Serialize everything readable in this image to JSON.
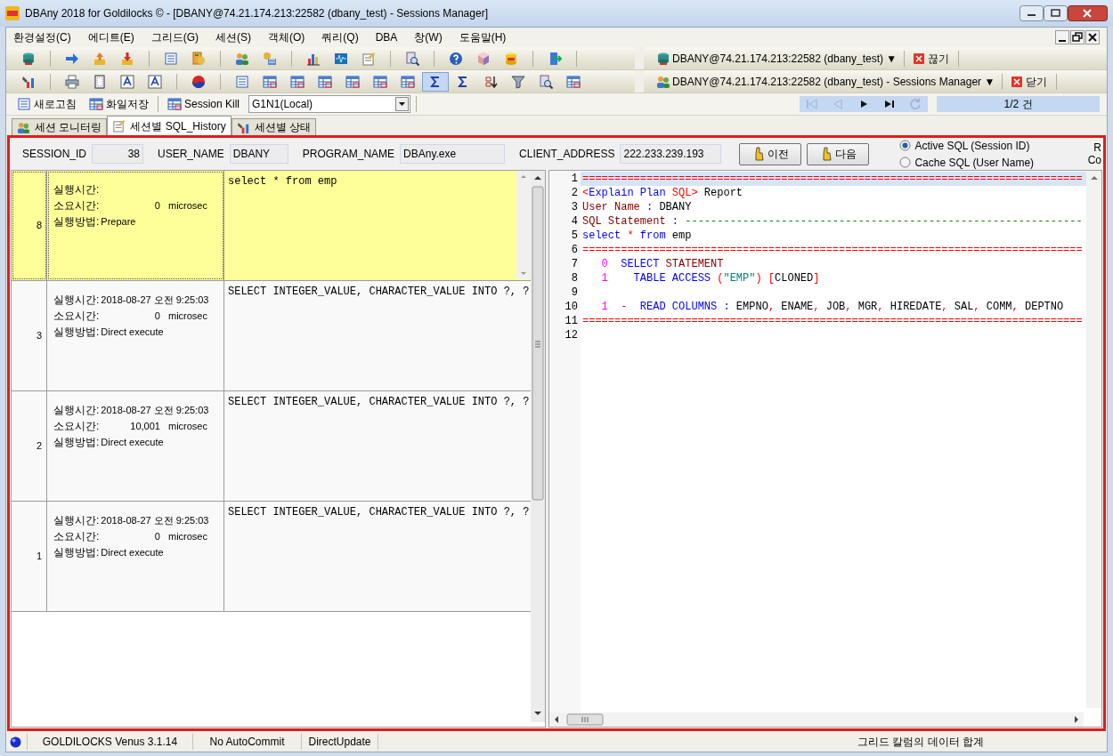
{
  "window": {
    "title": "DBAny 2018 for Goldilocks © - [DBANY@74.21.174.213:22582 (dbany_test) - Sessions Manager]"
  },
  "menu": [
    "환경설정(C)",
    "에디트(E)",
    "그리드(G)",
    "세션(S)",
    "객체(O)",
    "쿼리(Q)",
    "DBA",
    "창(W)",
    "도움말(H)"
  ],
  "connection_bars": [
    {
      "label": "DBANY@74.21.174.213:22582 (dbany_test) ▼",
      "action": "끊기"
    },
    {
      "label": "DBANY@74.21.174.213:22582 (dbany_test) - Sessions Manager ▼",
      "action": "닫기"
    }
  ],
  "session_toolbar": {
    "refresh": "새로고침",
    "save": "화일저장",
    "kill": "Session Kill",
    "node": "G1N1(Local)",
    "counter": "1/2 건"
  },
  "nav_buttons": [
    {
      "kind": "first",
      "disabled": true
    },
    {
      "kind": "prev",
      "disabled": true
    },
    {
      "kind": "next",
      "disabled": false
    },
    {
      "kind": "last",
      "disabled": false
    },
    {
      "kind": "refresh",
      "disabled": true
    }
  ],
  "tabs": [
    {
      "label": "세션 모니터링",
      "selected": false
    },
    {
      "label": "세션별 SQL_History",
      "selected": true
    },
    {
      "label": "세션별 상태",
      "selected": false
    }
  ],
  "session_fields": [
    {
      "label": "SESSION_ID",
      "value": "38"
    },
    {
      "label": "USER_NAME",
      "value": "DBANY"
    },
    {
      "label": "PROGRAM_NAME",
      "value": "DBAny.exe"
    },
    {
      "label": "CLIENT_ADDRESS",
      "value": "222.233.239.193"
    }
  ],
  "buttons": [
    "이전",
    "다음"
  ],
  "sql_source": [
    {
      "label": "Active SQL (Session ID)",
      "selected": true
    },
    {
      "label": "Cache SQL (User Name)",
      "selected": false
    }
  ],
  "cut_labels": [
    "R",
    "Co"
  ],
  "history": [
    {
      "number": "8",
      "selected": true,
      "exec_label": "실행시간:",
      "duration_label": "소요시간:",
      "duration": "0",
      "unit": "microsec",
      "method_label": "실행방법:",
      "method": "Prepare",
      "sql": "select * from emp"
    },
    {
      "number": "3",
      "selected": false,
      "exec_label": "실행시간:",
      "exec_time": "2018-08-27 오전 9:25:03",
      "duration_label": "소요시간:",
      "duration": "0",
      "unit": "microsec",
      "method_label": "실행방법:",
      "method": "Direct execute",
      "sql": "SELECT INTEGER_VALUE, CHARACTER_VALUE INTO ?, ?"
    },
    {
      "number": "2",
      "selected": false,
      "exec_label": "실행시간:",
      "exec_time": "2018-08-27 오전 9:25:03",
      "duration_label": "소요시간:",
      "duration": "10,001",
      "unit": "microsec",
      "method_label": "실행방법:",
      "method": "Direct execute",
      "sql": "SELECT INTEGER_VALUE, CHARACTER_VALUE INTO ?, ?"
    },
    {
      "number": "1",
      "selected": false,
      "exec_label": "실행시간:",
      "exec_time": "2018-08-27 오전 9:25:03",
      "duration_label": "소요시간:",
      "duration": "0",
      "unit": "microsec",
      "method_label": "실행방법:",
      "method": "Direct execute",
      "sql": "SELECT INTEGER_VALUE, CHARACTER_VALUE INTO ?, ?"
    }
  ],
  "editor": {
    "lines": [
      {
        "number": "1",
        "current": true,
        "tokens": [
          {
            "text": "==============================================================================",
            "kind": "operator"
          }
        ]
      },
      {
        "number": "2",
        "current": false,
        "tokens": [
          {
            "text": "<",
            "kind": "operator"
          },
          {
            "text": "Explain Plan",
            "kind": "keyword"
          },
          {
            "text": " SQL>",
            "kind": "operator"
          },
          {
            "text": " Report",
            "kind": "plain"
          }
        ]
      },
      {
        "number": "3",
        "current": false,
        "tokens": [
          {
            "text": "User Name",
            "kind": "ident"
          },
          {
            "text": " : ",
            "kind": "keyword"
          },
          {
            "text": "DBANY",
            "kind": "plain"
          }
        ]
      },
      {
        "number": "4",
        "current": false,
        "tokens": [
          {
            "text": "SQL Statement",
            "kind": "ident"
          },
          {
            "text": " : ",
            "kind": "keyword"
          },
          {
            "text": "--------------------------------------------------------------",
            "kind": "comment"
          }
        ]
      },
      {
        "number": "5",
        "current": false,
        "tokens": [
          {
            "text": "select",
            "kind": "keyword"
          },
          {
            "text": " * ",
            "kind": "operator"
          },
          {
            "text": "from",
            "kind": "keyword"
          },
          {
            "text": " emp",
            "kind": "plain"
          }
        ]
      },
      {
        "number": "6",
        "current": false,
        "tokens": [
          {
            "text": "==============================================================================",
            "kind": "operator"
          }
        ]
      },
      {
        "number": "7",
        "current": false,
        "tokens": [
          {
            "text": "   0",
            "kind": "number"
          },
          {
            "text": "  SELECT",
            "kind": "keyword"
          },
          {
            "text": " STATEMENT",
            "kind": "ident"
          }
        ]
      },
      {
        "number": "8",
        "current": false,
        "tokens": [
          {
            "text": "   1",
            "kind": "number"
          },
          {
            "text": "    TABLE ACCESS",
            "kind": "keyword"
          },
          {
            "text": " (",
            "kind": "operator"
          },
          {
            "text": "\"EMP\"",
            "kind": "string"
          },
          {
            "text": ") [",
            "kind": "operator"
          },
          {
            "text": "CLONED",
            "kind": "plain"
          },
          {
            "text": "]",
            "kind": "operator"
          }
        ]
      },
      {
        "number": "9",
        "current": false
      },
      {
        "number": "10",
        "current": false,
        "tokens": [
          {
            "text": "   1",
            "kind": "number"
          },
          {
            "text": "  -  ",
            "kind": "operator"
          },
          {
            "text": "READ COLUMNS",
            "kind": "keyword"
          },
          {
            "text": " : ",
            "kind": "keyword"
          },
          {
            "text": "EMPNO",
            "kind": "plain"
          },
          {
            "text": ", ",
            "kind": "operator"
          },
          {
            "text": "ENAME",
            "kind": "plain"
          },
          {
            "text": ", ",
            "kind": "operator"
          },
          {
            "text": "JOB",
            "kind": "plain"
          },
          {
            "text": ", ",
            "kind": "operator"
          },
          {
            "text": "MGR",
            "kind": "plain"
          },
          {
            "text": ", ",
            "kind": "operator"
          },
          {
            "text": "HIREDATE",
            "kind": "plain"
          },
          {
            "text": ", ",
            "kind": "operator"
          },
          {
            "text": "SAL",
            "kind": "plain"
          },
          {
            "text": ", ",
            "kind": "operator"
          },
          {
            "text": "COMM",
            "kind": "plain"
          },
          {
            "text": ", ",
            "kind": "operator"
          },
          {
            "text": "DEPTNO",
            "kind": "plain"
          }
        ]
      },
      {
        "number": "11",
        "current": false,
        "tokens": [
          {
            "text": "==============================================================================",
            "kind": "operator"
          }
        ]
      },
      {
        "number": "12",
        "current": false
      }
    ]
  },
  "status_bar": [
    "GOLDILOCKS Venus 3.1.14",
    "No AutoCommit",
    "DirectUpdate",
    "그리드 칼럼의 데이터 합계"
  ]
}
